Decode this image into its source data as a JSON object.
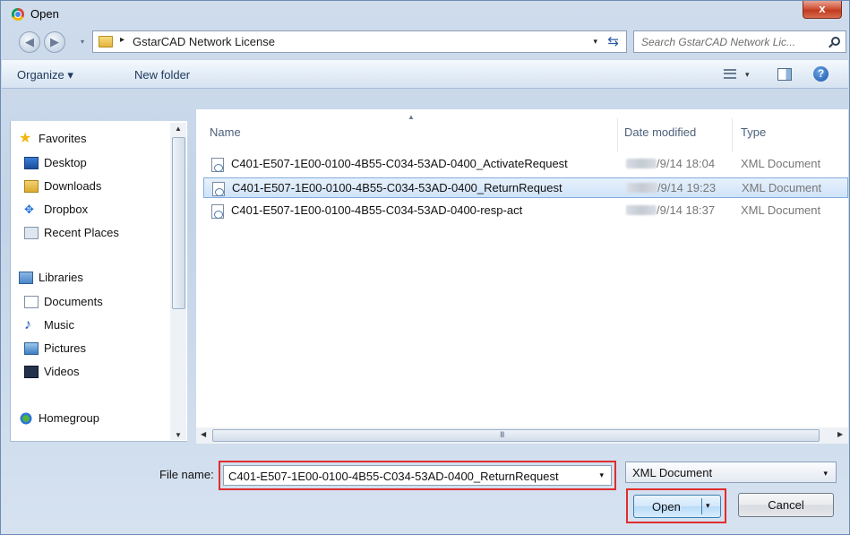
{
  "window": {
    "title": "Open",
    "close_symbol": "x"
  },
  "address": {
    "separator": "▸",
    "path": "GstarCAD Network License",
    "dropdown": "▾",
    "refresh": "⇆"
  },
  "search": {
    "placeholder": "Search GstarCAD Network Lic..."
  },
  "nav_buttons": {
    "back": "◀",
    "forward": "▶",
    "recent": "▾"
  },
  "toolbar": {
    "organize": "Organize ▾",
    "new_folder": "New folder",
    "view_dropdown": "▾",
    "help": "?"
  },
  "sidebar": {
    "items": [
      {
        "label": "Favorites",
        "icon": "star-icon",
        "group": true
      },
      {
        "label": "Desktop",
        "icon": "desktop-icon"
      },
      {
        "label": "Downloads",
        "icon": "downloads-icon"
      },
      {
        "label": "Dropbox",
        "icon": "dropbox-icon"
      },
      {
        "label": "Recent Places",
        "icon": "recent-places-icon"
      },
      {
        "label": "Libraries",
        "icon": "libraries-icon",
        "group": true
      },
      {
        "label": "Documents",
        "icon": "documents-icon"
      },
      {
        "label": "Music",
        "icon": "music-icon"
      },
      {
        "label": "Pictures",
        "icon": "pictures-icon"
      },
      {
        "label": "Videos",
        "icon": "videos-icon"
      },
      {
        "label": "Homegroup",
        "icon": "homegroup-icon",
        "group": true
      }
    ],
    "scroll_up": "▲",
    "scroll_down": "▼"
  },
  "file_list": {
    "columns": {
      "name": "Name",
      "date": "Date modified",
      "type": "Type"
    },
    "sort_arrow": "▲",
    "rows": [
      {
        "name": "C401-E507-1E00-0100-4B55-C034-53AD-0400_ActivateRequest",
        "date": "/9/14 18:04",
        "type": "XML Document",
        "selected": false
      },
      {
        "name": "C401-E507-1E00-0100-4B55-C034-53AD-0400_ReturnRequest",
        "date": "/9/14 19:23",
        "type": "XML Document",
        "selected": true
      },
      {
        "name": "C401-E507-1E00-0100-4B55-C034-53AD-0400-resp-act",
        "date": "/9/14 18:37",
        "type": "XML Document",
        "selected": false
      }
    ]
  },
  "hscroll": {
    "left": "◀",
    "right": "▶",
    "grip": "III"
  },
  "bottom": {
    "file_name_label": "File name:",
    "file_name_value": "C401-E507-1E00-0100-4B55-C034-53AD-0400_ReturnRequest",
    "file_name_dropdown": "▾",
    "file_type": "XML Document",
    "file_type_dropdown": "▾",
    "open_label": "Open",
    "open_dropdown": "▾",
    "cancel_label": "Cancel"
  },
  "colors": {
    "highlight_border": "#e02d2d",
    "selection": "#cfe3f9",
    "accent": "#2c5aa0"
  }
}
